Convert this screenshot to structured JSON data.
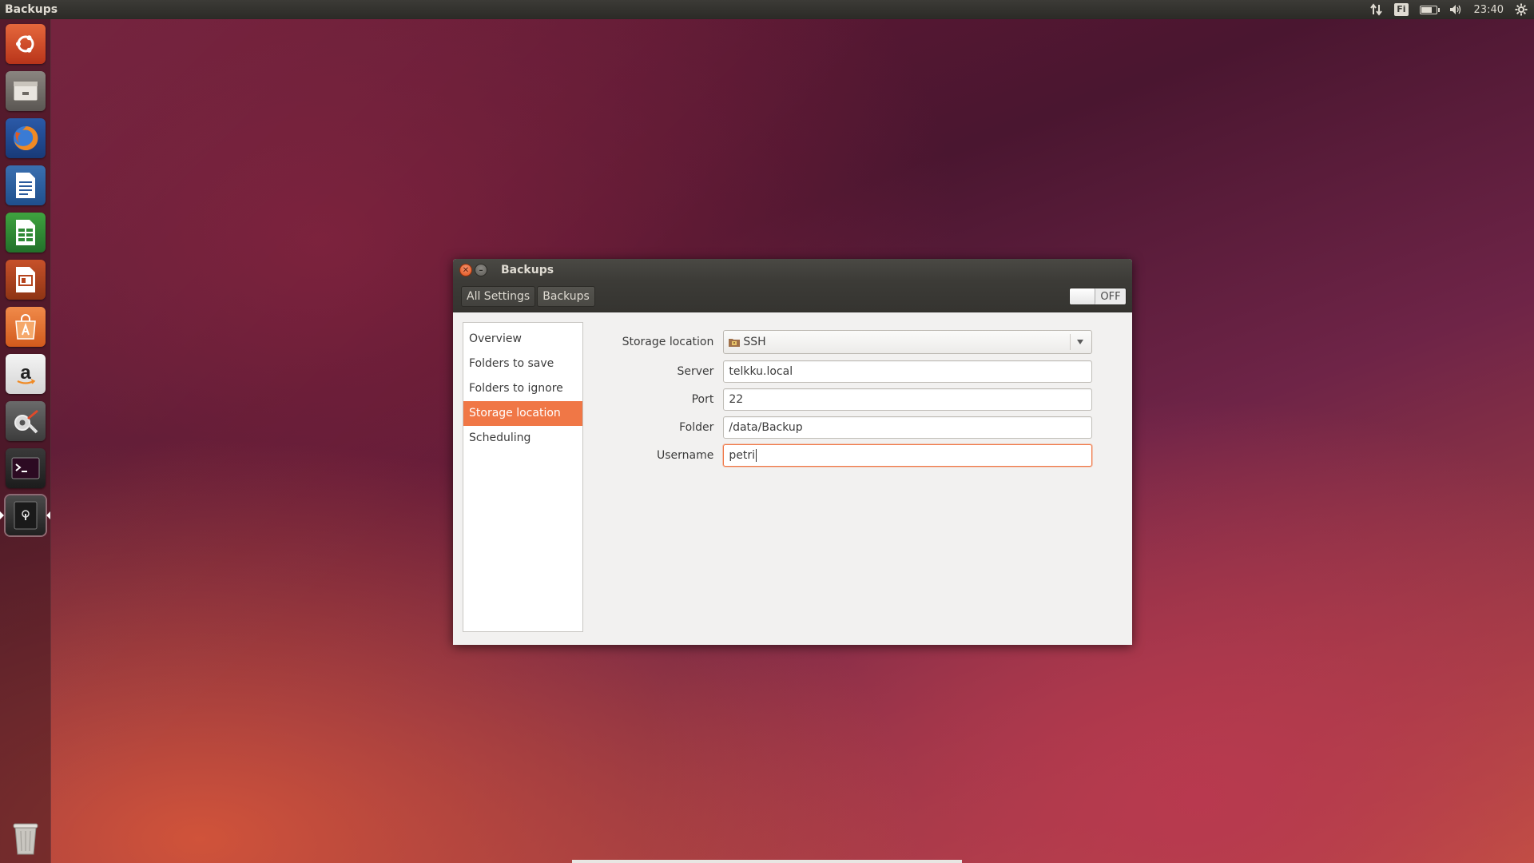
{
  "top_panel": {
    "app_title": "Backups",
    "keyboard_layout": "Fi",
    "clock": "23:40",
    "battery_fraction": 0.8
  },
  "launcher": {
    "items": [
      "ubuntu-dash",
      "files",
      "firefox",
      "libreoffice-writer",
      "libreoffice-calc",
      "libreoffice-impress",
      "ubuntu-software-center",
      "amazon",
      "system-settings",
      "terminal",
      "backups",
      "trash"
    ]
  },
  "window": {
    "title": "Backups",
    "breadcrumb": [
      "All Settings",
      "Backups"
    ],
    "switch_state": "OFF",
    "sidebar": {
      "items": [
        "Overview",
        "Folders to save",
        "Folders to ignore",
        "Storage location",
        "Scheduling"
      ],
      "active": "Storage location"
    },
    "form": {
      "storage_location_label": "Storage location",
      "storage_location_value": "SSH",
      "server_label": "Server",
      "server_value": "telkku.local",
      "port_label": "Port",
      "port_value": "22",
      "folder_label": "Folder",
      "folder_value": "/data/Backup",
      "username_label": "Username",
      "username_value": "petri"
    }
  },
  "colors": {
    "accent": "#f07746",
    "panel": "#3c3b37"
  }
}
